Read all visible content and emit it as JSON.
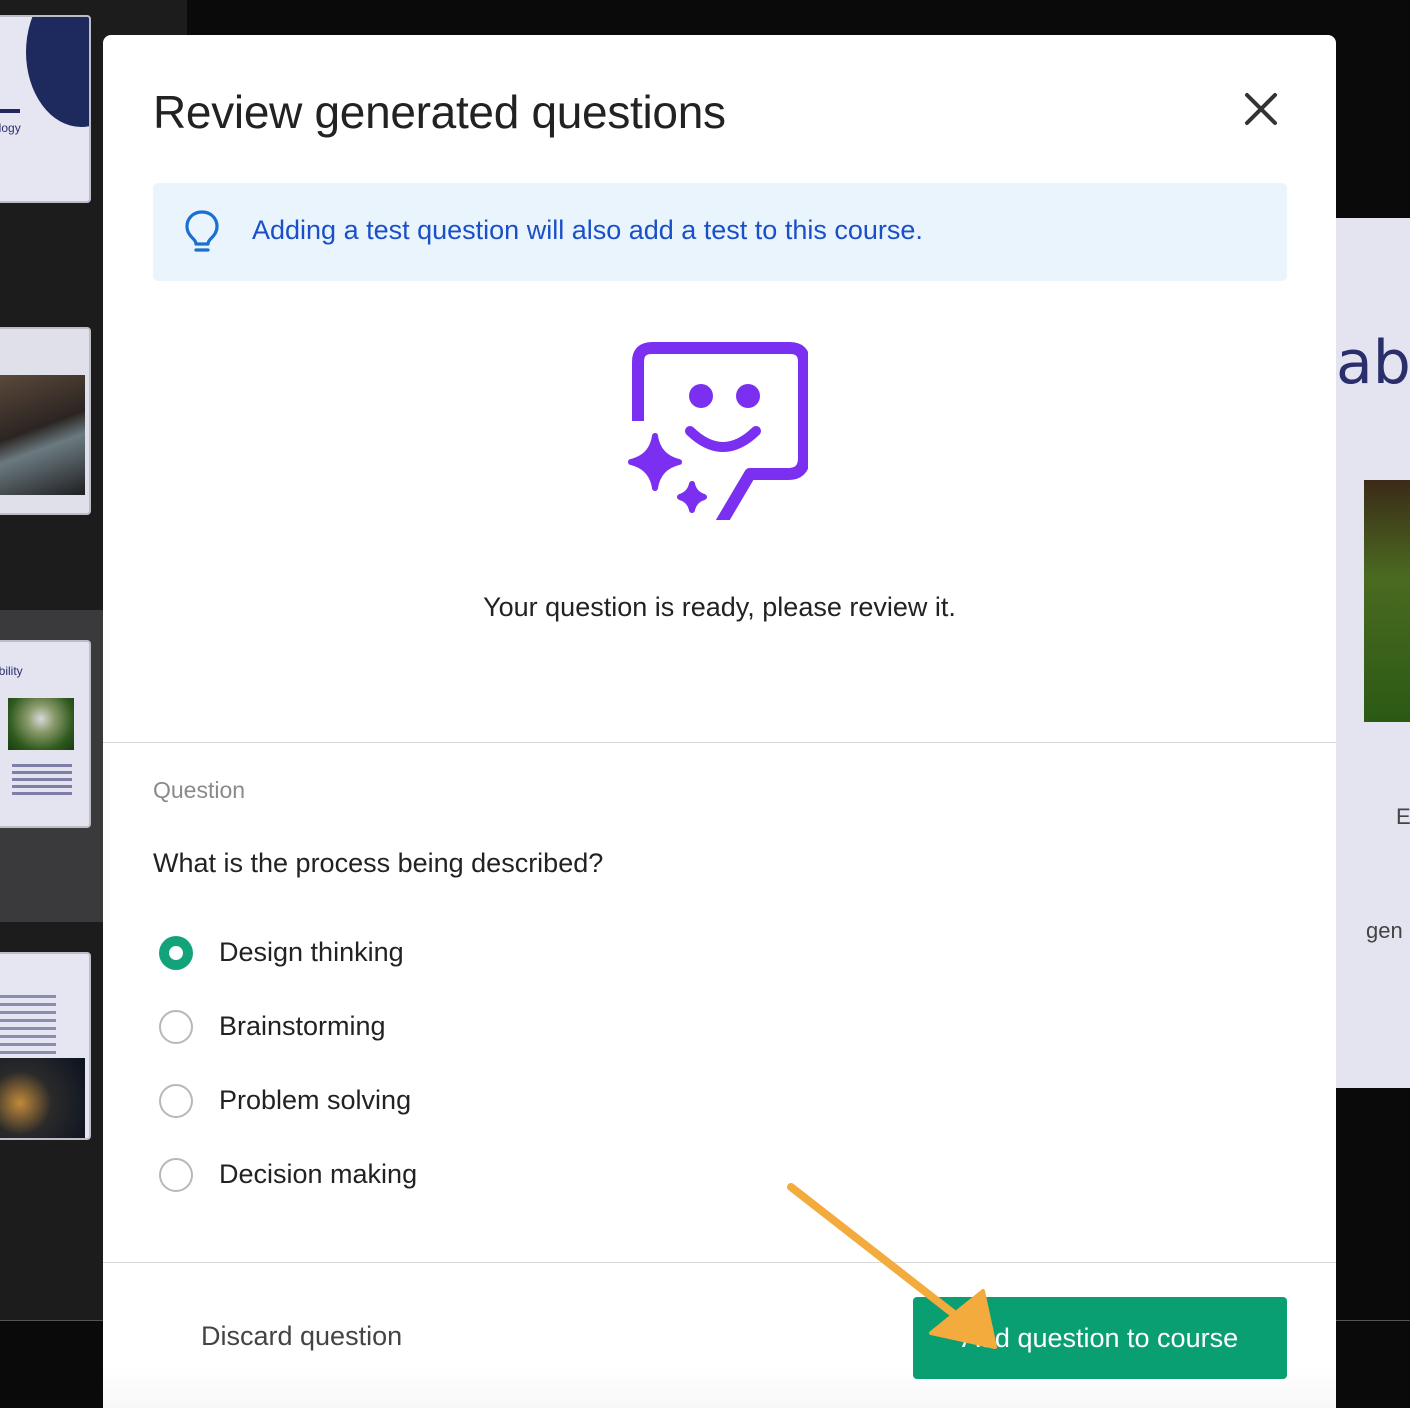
{
  "background": {
    "thumbnails": [
      {
        "text": "ology"
      },
      {
        "text": ""
      },
      {
        "text": "ability"
      },
      {
        "text": ""
      }
    ],
    "right_panel": {
      "big_text": "abil",
      "letter": "E",
      "word": "gen"
    }
  },
  "modal": {
    "title": "Review generated questions",
    "close_icon": "close-icon",
    "banner": {
      "icon": "lightbulb-icon",
      "text": "Adding a test question will also add a test to this course."
    },
    "hero": {
      "icon": "smiling-chat-sparkles-icon",
      "color": "#7b2ff0"
    },
    "status_text": "Your question is ready, please review it.",
    "question": {
      "label": "Question",
      "text": "What is the process being described?",
      "options": [
        {
          "label": "Design thinking",
          "selected": true
        },
        {
          "label": "Brainstorming",
          "selected": false
        },
        {
          "label": "Problem solving",
          "selected": false
        },
        {
          "label": "Decision making",
          "selected": false
        }
      ]
    },
    "footer": {
      "discard_label": "Discard question",
      "add_label": "Add question to course"
    }
  },
  "colors": {
    "accent_green": "#0a9e73",
    "banner_bg": "#e9f4fc",
    "banner_text": "#1a4fc9",
    "hero_purple": "#7b2ff0",
    "annotation_arrow": "#f2ab3c"
  }
}
